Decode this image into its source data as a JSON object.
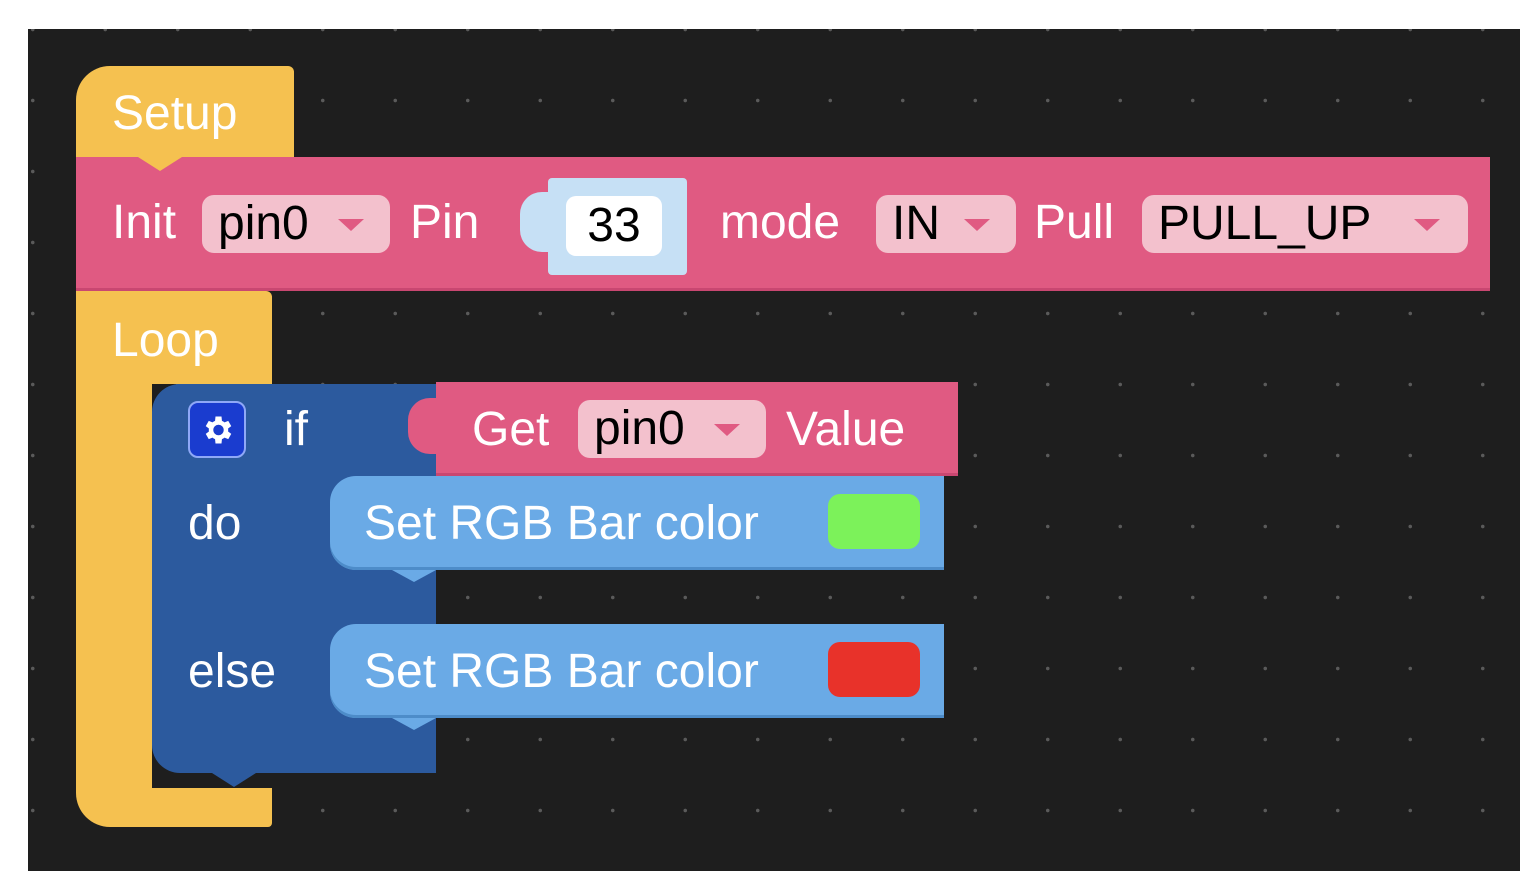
{
  "setup": {
    "label": "Setup"
  },
  "init": {
    "label": "Init",
    "pin_dropdown": "pin0",
    "pin_label": "Pin",
    "pin_number": "33",
    "mode_label": "mode",
    "mode_dropdown": "IN",
    "pull_label": "Pull",
    "pull_dropdown": "PULL_UP"
  },
  "loop": {
    "label": "Loop"
  },
  "if_block": {
    "if_label": "if",
    "do_label": "do",
    "else_label": "else",
    "condition": {
      "get_label": "Get",
      "pin_dropdown": "pin0",
      "value_label": "Value"
    }
  },
  "actions": {
    "do": {
      "label": "Set RGB Bar color",
      "color": "#7cf25a"
    },
    "else": {
      "label": "Set RGB Bar color",
      "color": "#e8322a"
    }
  },
  "colors": {
    "workspace": "#1e1e1e",
    "event_block": "#f5c150",
    "io_block": "#e05a82",
    "logic_block": "#2c5a9e",
    "rgb_block": "#6aaae6"
  },
  "icons": {
    "mutator": "gear-icon",
    "dropdown": "chevron-down-icon"
  }
}
